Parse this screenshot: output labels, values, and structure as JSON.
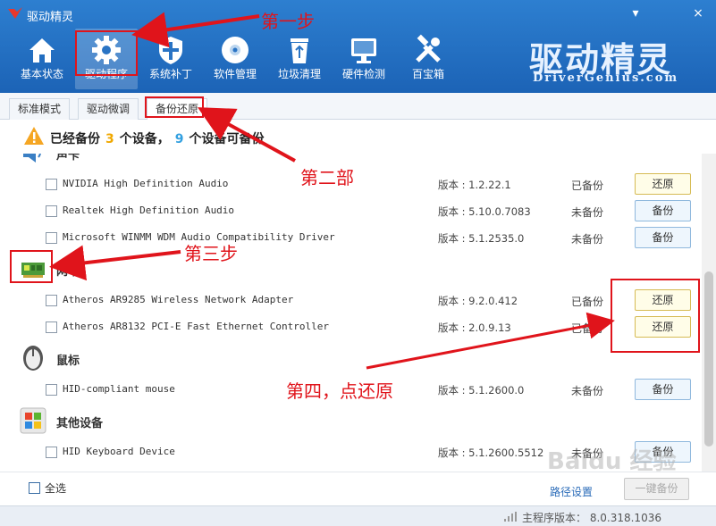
{
  "window": {
    "title": "驱动精灵",
    "minimize": "▾",
    "close": "×"
  },
  "toolbar": [
    {
      "label": "基本状态",
      "icon": "home-icon"
    },
    {
      "label": "驱动程序",
      "icon": "gear-icon",
      "active": true
    },
    {
      "label": "系统补丁",
      "icon": "shield-icon"
    },
    {
      "label": "软件管理",
      "icon": "disc-icon"
    },
    {
      "label": "垃圾清理",
      "icon": "recycle-bin-icon"
    },
    {
      "label": "硬件检测",
      "icon": "monitor-icon"
    },
    {
      "label": "百宝箱",
      "icon": "tools-icon"
    }
  ],
  "brand": {
    "cn": "驱动精灵",
    "en": "DriverGenius.com"
  },
  "tabs": [
    {
      "label": "标准模式"
    },
    {
      "label": "驱动微调"
    },
    {
      "label": "备份还原",
      "active": true
    }
  ],
  "summary": {
    "prefix": "已经备份",
    "backed_count": "3",
    "mid": "个设备，",
    "available_count": "9",
    "suffix": "个设备可备份"
  },
  "categories": {
    "audio": {
      "name": "声卡",
      "icon": "speaker-icon"
    },
    "network": {
      "name": "网卡",
      "icon": "network-card-icon"
    },
    "mouse": {
      "name": "鼠标",
      "icon": "mouse-icon"
    },
    "other": {
      "name": "其他设备",
      "icon": "windows-icon"
    }
  },
  "devices": [
    {
      "name": "NVIDIA High Definition Audio",
      "version": "版本 : 1.2.22.1",
      "status": "已备份",
      "action": "还原"
    },
    {
      "name": "Realtek High Definition Audio",
      "version": "版本 : 5.10.0.7083",
      "status": "未备份",
      "action": "备份"
    },
    {
      "name": "Microsoft WINMM WDM Audio Compatibility Driver",
      "version": "版本 : 5.1.2535.0",
      "status": "未备份",
      "action": "备份"
    },
    {
      "name": "Atheros AR9285 Wireless Network Adapter",
      "version": "版本 : 9.2.0.412",
      "status": "已备份",
      "action": "还原"
    },
    {
      "name": "Atheros AR8132 PCI-E Fast Ethernet Controller",
      "version": "版本 : 2.0.9.13",
      "status": "已备份",
      "action": "还原"
    },
    {
      "name": "HID-compliant mouse",
      "version": "版本 : 5.1.2600.0",
      "status": "未备份",
      "action": "备份"
    },
    {
      "name": "HID Keyboard Device",
      "version": "版本 : 5.1.2600.5512",
      "status": "未备份",
      "action": "备份"
    }
  ],
  "footer": {
    "select_all": "全选",
    "path_settings": "路径设置",
    "batch_button": "一键备份"
  },
  "statusbar": {
    "version": "主程序版本： 8.0.318.1036"
  },
  "annotations": {
    "step1": "第一步",
    "step2": "第二部",
    "step3": "第三步",
    "step4": "第四，点还原"
  },
  "watermark": "Baidu 经验",
  "colors": {
    "annotation": "#e0141b",
    "title_bar": "#1c63b6",
    "accent_yellow": "#f0a800",
    "accent_blue": "#33a0e0"
  }
}
